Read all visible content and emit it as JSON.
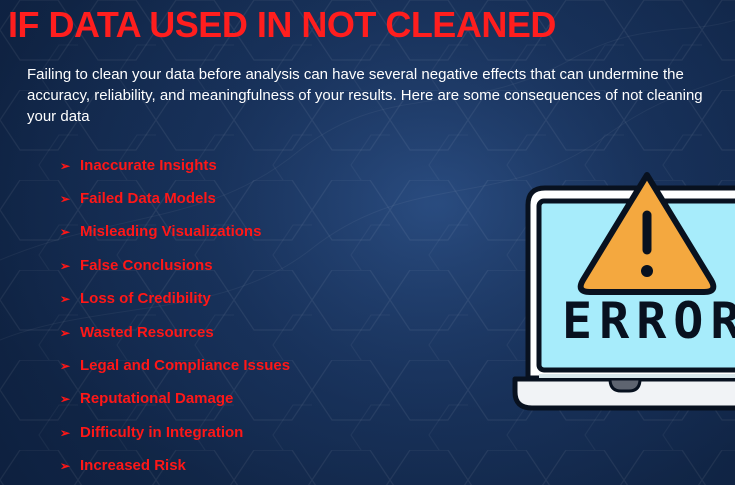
{
  "slide": {
    "title": "IF DATA USED IN NOT CLEANED",
    "intro": "Failing to clean your data before analysis can have several negative effects that can undermine the accuracy, reliability, and meaningfulness of your results. Here are some consequences of not cleaning your data",
    "bullet_symbol": "➢",
    "bullets": [
      "Inaccurate Insights",
      "Failed Data Models",
      "Misleading Visualizations",
      "False Conclusions",
      "Loss of Credibility",
      "Wasted Resources",
      "Legal and Compliance Issues",
      "Reputational Damage",
      "Difficulty in Integration",
      "Increased Risk"
    ],
    "illustration": {
      "icon": "error-laptop-icon",
      "label": "ERROR"
    }
  },
  "colors": {
    "background_dark": "#0f2446",
    "background_mid": "#173058",
    "title_red": "#ff1e1e",
    "bullet_red": "#ff1717",
    "screen_blue": "#a7ecfb",
    "warning_orange": "#f4a83f",
    "outline": "#08111f"
  }
}
